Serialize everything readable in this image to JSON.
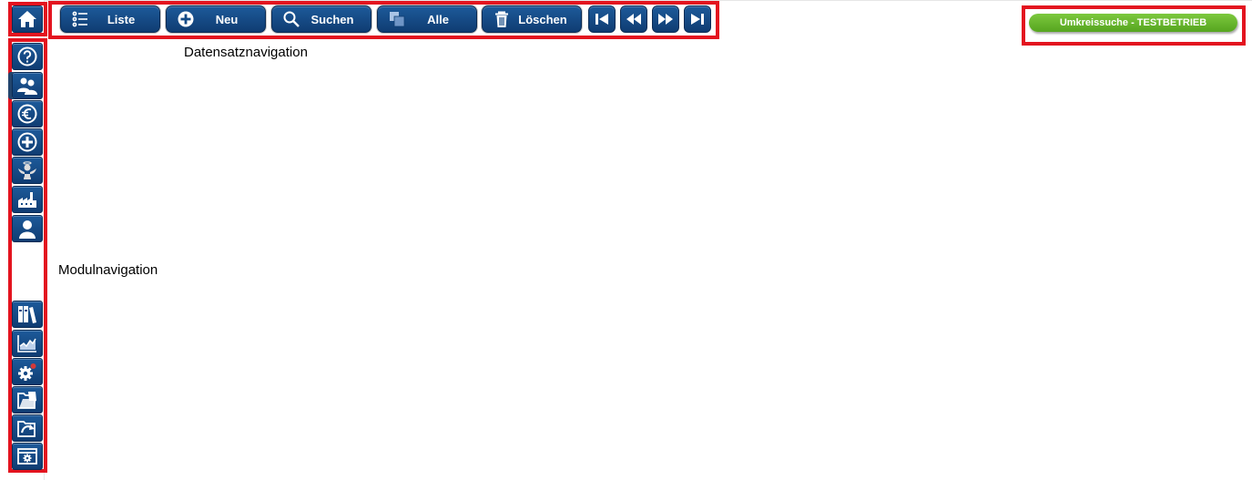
{
  "toolbar": {
    "liste": "Liste",
    "neu": "Neu",
    "suchen": "Suchen",
    "alle": "Alle",
    "loeschen": "Löschen"
  },
  "record_nav": [
    "first-record-icon",
    "previous-record-icon",
    "next-record-icon",
    "last-record-icon"
  ],
  "badge": "Umkreissuche - TESTBETRIEB",
  "captions": {
    "toolbar": "Datensatznavigation",
    "sidebar": "Modulnavigation"
  },
  "sidebar_icons": [
    "help-icon",
    "users-icon",
    "euro-icon",
    "plus-icon",
    "angel-icon",
    "factory-icon",
    "person-icon",
    "binders-icon",
    "chart-icon",
    "settings-icon",
    "folder-open-icon",
    "folder-arrow-icon",
    "window-gear-icon"
  ],
  "colors": {
    "button": "#134a86",
    "highlight": "#e3141f",
    "badge": "#6bb82f"
  }
}
